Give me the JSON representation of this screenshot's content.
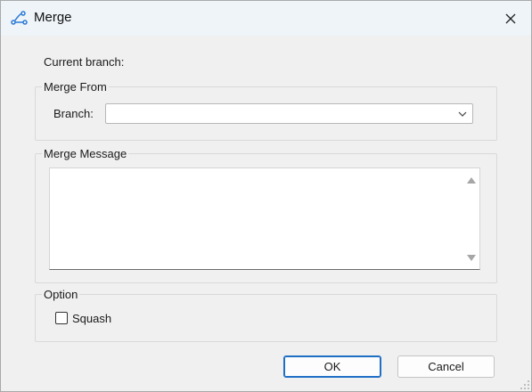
{
  "window": {
    "title": "Merge",
    "icon": "merge-branch-icon"
  },
  "current_branch": {
    "label": "Current branch:",
    "value": ""
  },
  "merge_from": {
    "legend": "Merge From",
    "branch_label": "Branch:",
    "branch_value": ""
  },
  "merge_message": {
    "legend": "Merge Message",
    "text": ""
  },
  "option": {
    "legend": "Option",
    "squash_label": "Squash",
    "squash_checked": false
  },
  "buttons": {
    "ok": "OK",
    "cancel": "Cancel"
  },
  "colors": {
    "titlebar": "#eef4f8",
    "dialog_bg": "#f0f0f0",
    "default_button_border": "#1f6fc5",
    "icon_blue": "#2c7ad6"
  }
}
